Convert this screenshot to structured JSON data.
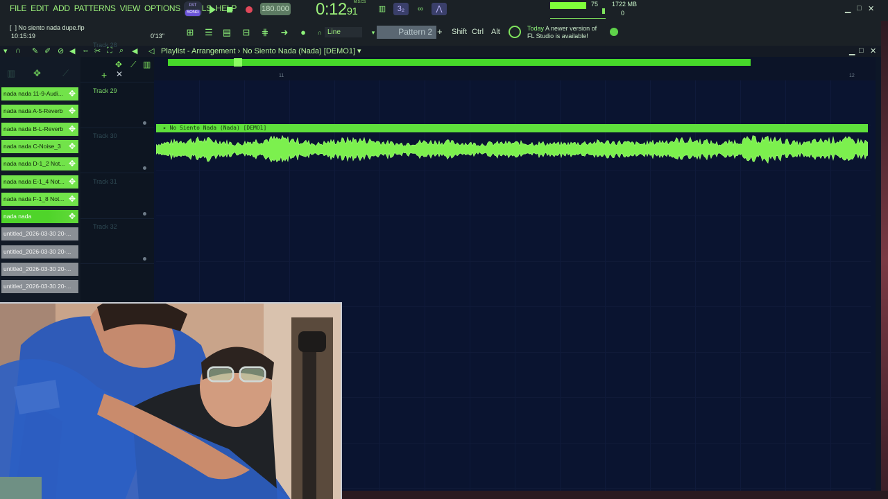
{
  "menu": [
    "FILE",
    "EDIT",
    "ADD",
    "PATTERNS",
    "VIEW",
    "OPTIONS",
    "TOOLS",
    "HELP"
  ],
  "transport": {
    "pat_label": "PAT",
    "song_label": "SONG",
    "tempo": "180.000",
    "time_main": "0:12",
    "time_sub": "91",
    "time_unit_label": "M:S:CS"
  },
  "status": {
    "cpu": "75",
    "memory": "1722 MB",
    "polyphony": "0"
  },
  "file": {
    "name": "No siento nada dupe.flp",
    "clock": "10:15:19",
    "length": "0'13\""
  },
  "toolbar2": {
    "snap": "Line",
    "pattern": "Pattern 2",
    "modifiers": [
      "Shift",
      "Ctrl",
      "Alt"
    ]
  },
  "news": {
    "day": "Today",
    "line1": "A newer version of",
    "line2": "FL Studio is available!"
  },
  "playlist": {
    "title": "Playlist - Arrangement › No Siento Nada (Nada) [DEMO1] ▾"
  },
  "clips": [
    {
      "label": "nada nada 11-9-Audi...",
      "style": "green"
    },
    {
      "label": "nada nada A-5-Reverb",
      "style": "green"
    },
    {
      "label": "nada nada B-L-Reverb",
      "style": "green"
    },
    {
      "label": "nada nada C-Noise_3",
      "style": "green"
    },
    {
      "label": "nada nada D-1_2 Not...",
      "style": "green"
    },
    {
      "label": "nada nada E-1_4 Not...",
      "style": "green"
    },
    {
      "label": "nada nada F-1_8 Not...",
      "style": "green"
    },
    {
      "label": "nada nada",
      "style": "sel"
    },
    {
      "label": "untitled_2026-03-30 20-...",
      "style": "gray"
    },
    {
      "label": "untitled_2026-03-30 20-...",
      "style": "gray"
    },
    {
      "label": "untitled_2026-03-30 20-...",
      "style": "gray"
    },
    {
      "label": "untitled_2026-03-30 20-...",
      "style": "gray"
    }
  ],
  "tracks": [
    {
      "name": "Track 28",
      "active": false
    },
    {
      "name": "Track 29",
      "active": true
    },
    {
      "name": "Track 30",
      "active": false
    },
    {
      "name": "Track 31",
      "active": false
    },
    {
      "name": "Track 32",
      "active": false
    }
  ],
  "timeline": {
    "bar_left": "11",
    "bar_right": "12"
  },
  "audio_clip": {
    "label": "No Siento Nada (Nada) [DEMO1]"
  },
  "colors": {
    "accent": "#5fe03c",
    "background": "#0a1430",
    "record": "#e0485a"
  }
}
